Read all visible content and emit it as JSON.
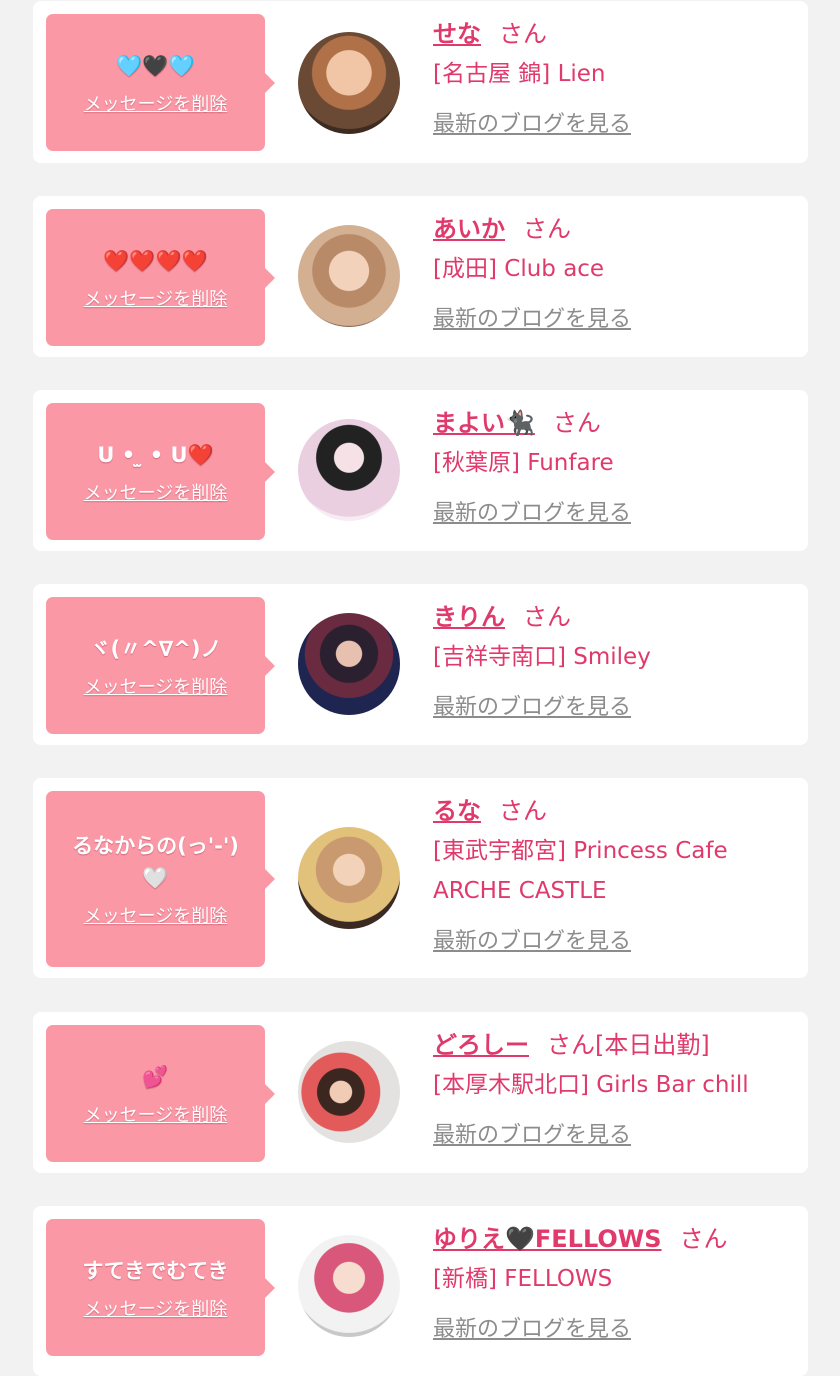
{
  "delete_label": "メッセージを削除",
  "blog_label": "最新のブログを見る",
  "honorific": "さん",
  "colors": {
    "page_bg": "#f2f2f2",
    "card_bg": "#ffffff",
    "bubble_bg": "#fb98a6",
    "accent_pink": "#e03a6c",
    "link_gray": "#8c8c8c"
  },
  "entries": [
    {
      "message": "🩵🖤🩵",
      "name": "せな",
      "suffix": "",
      "shop": "[名古屋 錦] Lien",
      "avatar_icon": "girl-photo-dog-filter"
    },
    {
      "message": "❤️❤️❤️❤️",
      "name": "あいか",
      "suffix": "",
      "shop": "[成田] Club ace",
      "avatar_icon": "girl-photo-dog-filter"
    },
    {
      "message": "U • ̫ • U❤️",
      "name": "まよい🐈‍⬛",
      "suffix": "",
      "shop": "[秋葉原] Funfare",
      "avatar_icon": "girl-photo"
    },
    {
      "message": "ヾ(〃^∇^)ノ",
      "name": "きりん",
      "suffix": "",
      "shop": "[吉祥寺南口] Smiley",
      "avatar_icon": "girl-photo-fan"
    },
    {
      "message": "るなからの(っ'-')\n🤍",
      "name": "るな",
      "suffix": "",
      "shop": "[東武宇都宮] Princess Cafe\nARCHE CASTLE",
      "avatar_icon": "girl-photo-cat-filter"
    },
    {
      "message": "💕",
      "name": "どろしー",
      "suffix": "[本日出勤]",
      "shop": "[本厚木駅北口] Girls Bar chill",
      "avatar_icon": "girl-photo-mirror"
    },
    {
      "message": "すてきでむてき",
      "name": "ゆりえ🖤FELLOWS",
      "suffix": "",
      "shop": "[新橋] FELLOWS",
      "avatar_icon": "girl-photo-pink-hair"
    }
  ]
}
